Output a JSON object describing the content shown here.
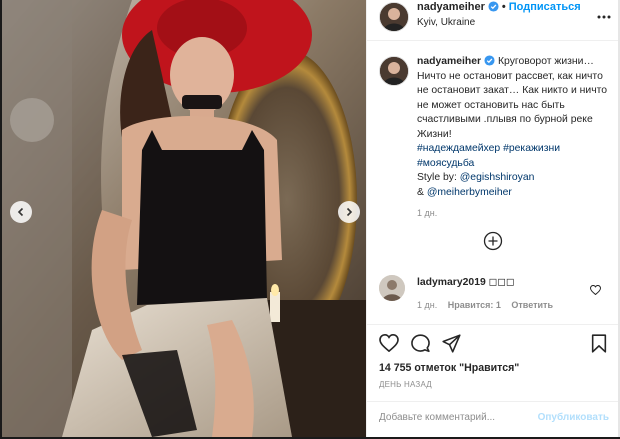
{
  "post": {
    "image_description_icon": "photo",
    "nav_prev_icon": "chevron-left-icon",
    "nav_next_icon": "chevron-right-icon"
  },
  "header": {
    "username": "nadyameiher",
    "separator": "•",
    "follow_label": "Подписаться",
    "location": "Kyiv, Ukraine",
    "verified_color": "#3897f0"
  },
  "caption": {
    "username": "nadyameiher",
    "text": "Круговорот жизни… Ничто не остановит рассвет, как ничто не остановит закат… Как никто и ничто не может остановить нас быть счастливыми .плывя по бурной реке Жизни!",
    "hashtags": [
      "#надеждамейхер",
      "#рекажизни",
      "#моясудьба"
    ],
    "style_prefix": "Style by: ",
    "style_mention_1": "@egishshiroyan",
    "style_joiner": "& ",
    "style_mention_2": "@meiherbymeiher",
    "time": "1 дн."
  },
  "reply": {
    "username": "ladymary2019",
    "text": "◻◻◻",
    "time": "1 дн.",
    "likes": "Нравится: 1",
    "reply_label": "Ответить"
  },
  "actions": {
    "likes_count": "14 755 отметок \"Нравится\"",
    "date": "день назад"
  },
  "comment_box": {
    "placeholder": "Добавьте комментарий...",
    "publish_label": "Опубликовать"
  },
  "colors": {
    "link": "#00376b",
    "follow": "#0095f6",
    "publish_disabled": "#b2dffc",
    "muted": "#8e8e8e"
  }
}
